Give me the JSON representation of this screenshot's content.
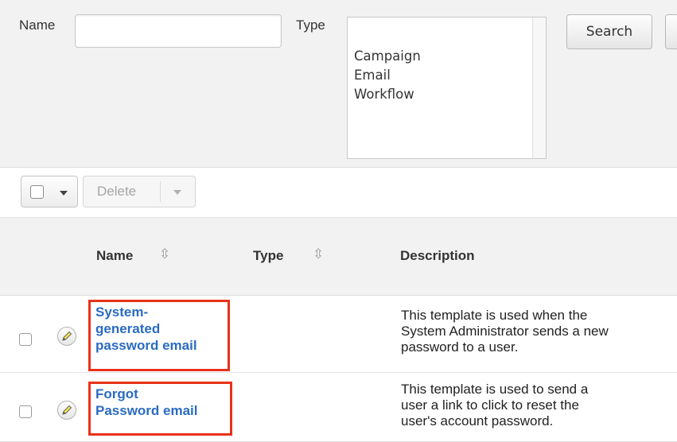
{
  "search": {
    "name_label": "Name",
    "name_value": "",
    "type_label": "Type",
    "type_options": [
      "Campaign",
      "Email",
      "Workflow"
    ],
    "search_label": "Search"
  },
  "toolbar": {
    "delete_label": "Delete"
  },
  "table": {
    "headers": {
      "name": "Name",
      "type": "Type",
      "description": "Description"
    },
    "rows": [
      {
        "name_lines": [
          "System-",
          "generated",
          "password email"
        ],
        "type": "",
        "description_lines": [
          "This template is used when the",
          "System Administrator sends a new",
          "password to a user."
        ]
      },
      {
        "name_lines": [
          "Forgot",
          "Password email"
        ],
        "type": "",
        "description_lines": [
          "This template is used to send a",
          "user a link to click to reset the",
          "user's account password."
        ]
      }
    ]
  },
  "colors": {
    "link": "#2a6bc2",
    "highlight_box": "#e8321a",
    "panel_bg": "#f2f2f2"
  },
  "icons": {
    "sort": "sort-arrows-icon",
    "edit": "pencil-icon",
    "dropdown": "caret-down-icon"
  }
}
